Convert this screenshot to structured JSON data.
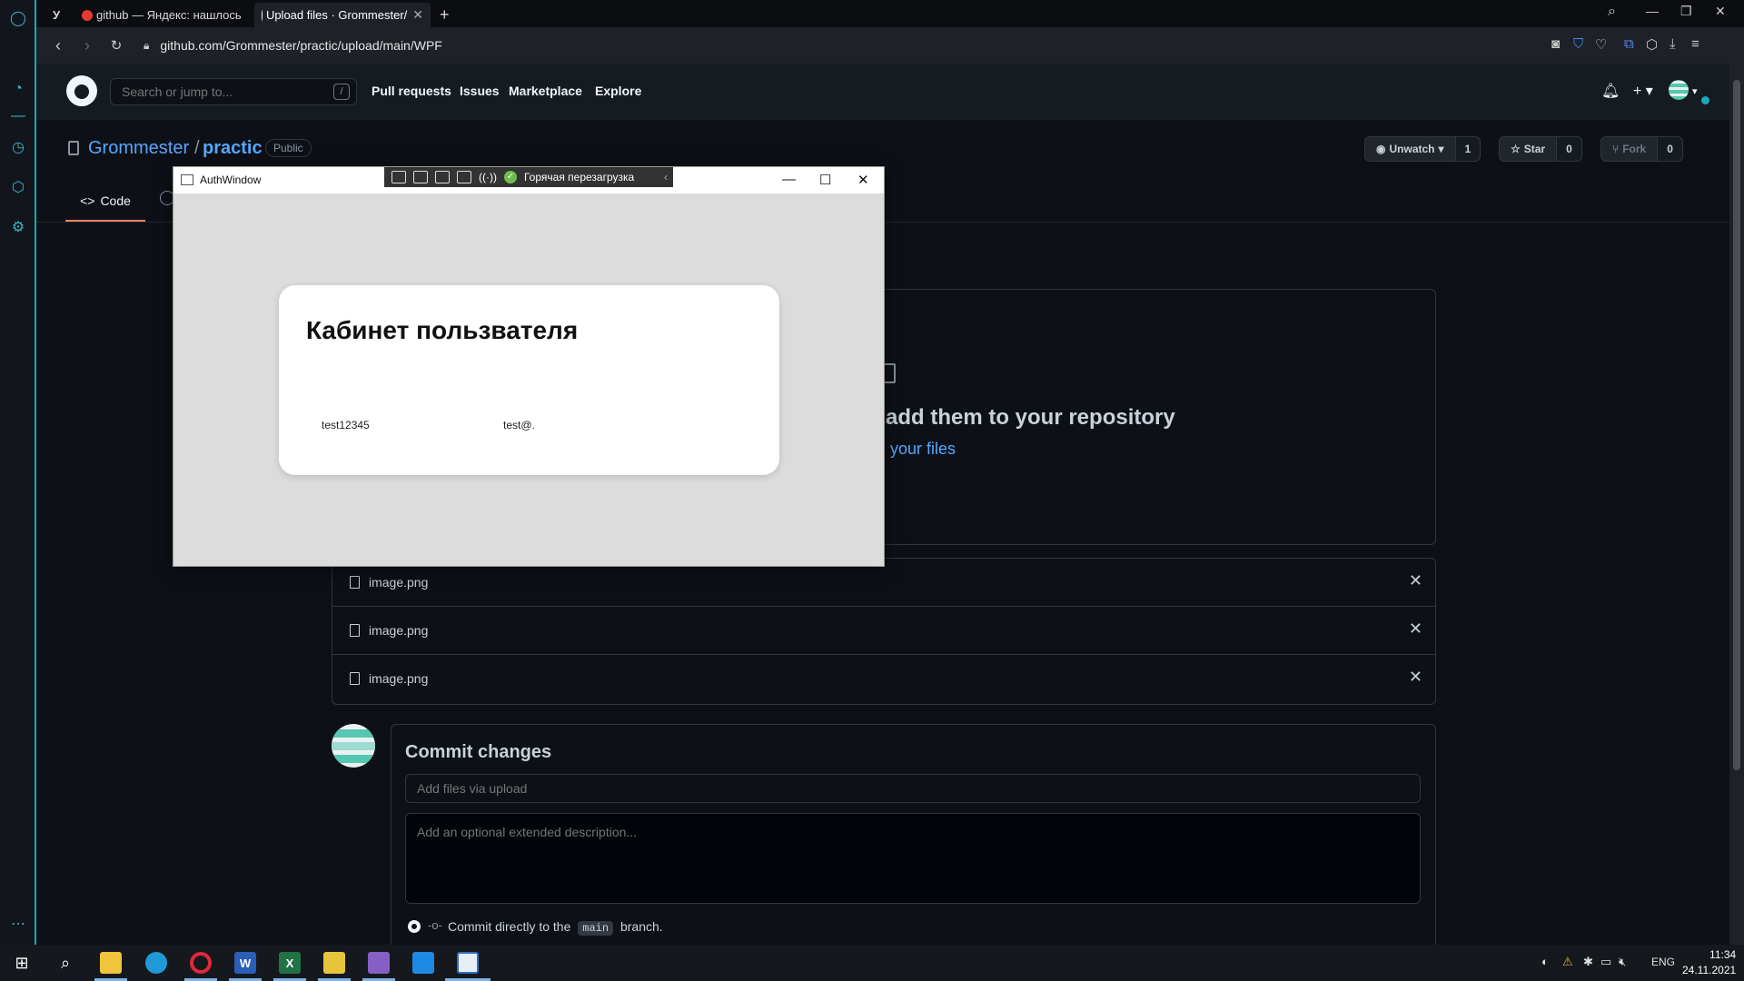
{
  "browser": {
    "tabs": [
      {
        "label": "У"
      },
      {
        "label": "github — Яндекс: нашлось"
      },
      {
        "label": "Upload files · Grommester/"
      }
    ],
    "url": "github.com/Grommester/practic/upload/main/WPF"
  },
  "github": {
    "search_placeholder": "Search or jump to...",
    "search_key": "/",
    "nav": [
      "Pull requests",
      "Issues",
      "Marketplace",
      "Explore"
    ],
    "repo": {
      "owner": "Grommester",
      "separator": "/",
      "name": "practic",
      "visibility": "Public",
      "watch_label": "Unwatch",
      "watch_count": "1",
      "star_label": "Star",
      "star_count": "0",
      "fork_label": "Fork",
      "fork_count": "0",
      "tab_code": "Code"
    },
    "upload": {
      "title": "add them to your repository",
      "link": "your files",
      "files": [
        {
          "name": "image.png"
        },
        {
          "name": "image.png"
        },
        {
          "name": "image.png"
        }
      ]
    },
    "commit": {
      "title": "Commit changes",
      "summary_placeholder": "Add files via upload",
      "desc_placeholder": "Add an optional extended description...",
      "option_prefix": "Commit directly to the",
      "branch": "main",
      "option_suffix": "branch."
    }
  },
  "auth_window": {
    "title": "AuthWindow",
    "hot_reload": "Горячая перезагрузка",
    "card_title": "Кабинет пользвателя",
    "login": "test12345",
    "email": "test@."
  },
  "taskbar": {
    "lang": "ENG",
    "time": "11:34",
    "date": "24.11.2021"
  },
  "colors": {
    "accent_link": "#58a6ff",
    "opera_accent": "#1aa9b8",
    "tab_underline": "#f78166"
  }
}
